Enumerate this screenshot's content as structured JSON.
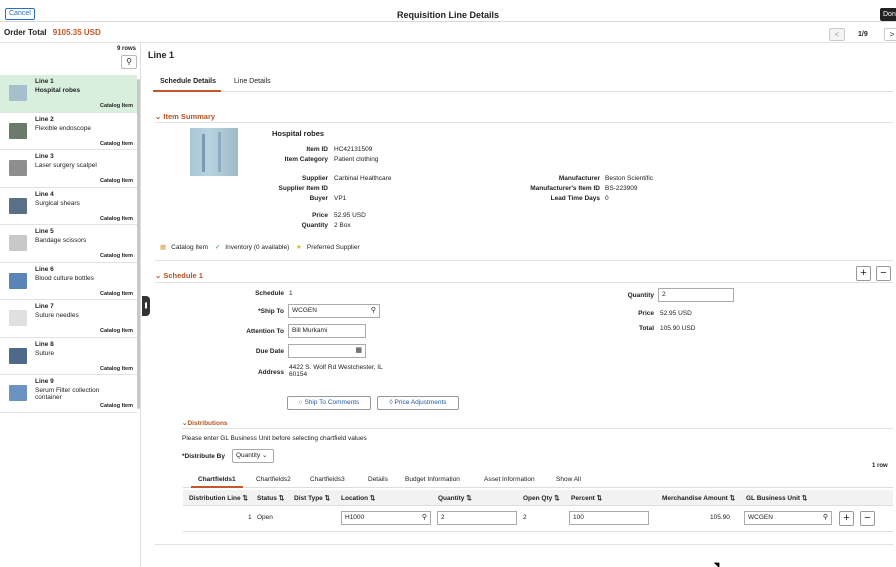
{
  "header": {
    "cancel": "Cancel",
    "title": "Requisition Line Details",
    "done": "Done"
  },
  "order": {
    "label": "Order Total",
    "amount": "9105.35 USD"
  },
  "pager": {
    "prev": "<",
    "text": "1/9",
    "next": ">"
  },
  "list": {
    "rows": "9 rows",
    "items": [
      {
        "line": "Line 1",
        "name": "Hospital robes",
        "tag": "Catalog Item",
        "thumb": "#a5bfcc"
      },
      {
        "line": "Line 2",
        "name": "Flexible endoscope",
        "tag": "Catalog Item",
        "thumb": "#6b7a6a"
      },
      {
        "line": "Line 3",
        "name": "Laser surgery scalpel",
        "tag": "Catalog Item",
        "thumb": "#8e8e8e"
      },
      {
        "line": "Line 4",
        "name": "Surgical shears",
        "tag": "Catalog Item",
        "thumb": "#5b6f86"
      },
      {
        "line": "Line 5",
        "name": "Bandage scissors",
        "tag": "Catalog Item",
        "thumb": "#c8c8c8"
      },
      {
        "line": "Line 6",
        "name": "Blood culture bottles",
        "tag": "Catalog Item",
        "thumb": "#5a84b8"
      },
      {
        "line": "Line 7",
        "name": "Suture needles",
        "tag": "Catalog Item",
        "thumb": "#e0e0e0"
      },
      {
        "line": "Line 8",
        "name": "Suture",
        "tag": "Catalog Item",
        "thumb": "#4e6a88"
      },
      {
        "line": "Line 9",
        "name": "Serum Filter collection container",
        "tag": "Catalog Item",
        "thumb": "#6c92c2"
      }
    ]
  },
  "main": {
    "heading": "Line 1",
    "tabs": [
      "Schedule Details",
      "Line Details"
    ]
  },
  "summary": {
    "title": "Item Summary",
    "item_name": "Hospital robes",
    "item_id_label": "Item ID",
    "item_id": "HC42131509",
    "category_label": "Item Category",
    "category": "Patient clothing",
    "supplier_label": "Supplier",
    "supplier": "Carbinal Healthcare",
    "supplier_item_label": "Supplier Item ID",
    "supplier_item": "",
    "buyer_label": "Buyer",
    "buyer": "VP1",
    "price_label": "Price",
    "price": "52.95 USD",
    "quantity_label": "Quantity",
    "quantity": "2 Box",
    "manufacturer_label": "Manufacturer",
    "manufacturer": "Beston Scientific",
    "mfr_item_label": "Manufacturer's Item ID",
    "mfr_item": "BS-223909",
    "lead_label": "Lead Time Days",
    "lead": "0",
    "badge_catalog": "Catalog Item",
    "badge_inventory": "Inventory (0 available)",
    "badge_preferred": "Preferred Supplier"
  },
  "schedule": {
    "title": "Schedule 1",
    "schedule_label": "Schedule",
    "schedule": "1",
    "shipto_label": "*Ship To",
    "shipto": "WCGEN",
    "attention_label": "Attention To",
    "attention": "Bill Murkami",
    "due_label": "Due Date",
    "due": "",
    "address_label": "Address",
    "address_line1": "4422 S. Wolf Rd Westchester, IL",
    "address_line2": "60154",
    "qty_label": "Quantity",
    "qty": "2",
    "price_label": "Price",
    "price": "52.95 USD",
    "total_label": "Total",
    "total": "105.90 USD",
    "ship_comments": "Ship To Comments",
    "price_adjust": "Price Adjustments"
  },
  "distributions": {
    "title": "Distributions",
    "message": "Please enter GL Business Unit before selecting chartfield values",
    "dist_by_label": "*Distribute By",
    "dist_by": "Quantity",
    "rows": "1 row",
    "tabs": [
      "Chartfields1",
      "Chartfields2",
      "Chartfields3",
      "Details",
      "Budget Information",
      "Asset Information",
      "Show All"
    ],
    "columns": [
      "Distribution Line",
      "Status",
      "Dist Type",
      "Location",
      "Quantity",
      "Open Qty",
      "Percent",
      "Merchandise Amount",
      "GL Business Unit"
    ],
    "row": {
      "line": "1",
      "status": "Open",
      "type": "",
      "location": "H1000",
      "quantity": "2",
      "open_qty": "2",
      "percent": "100",
      "amount": "105.90",
      "gl": "WCGEN"
    }
  }
}
